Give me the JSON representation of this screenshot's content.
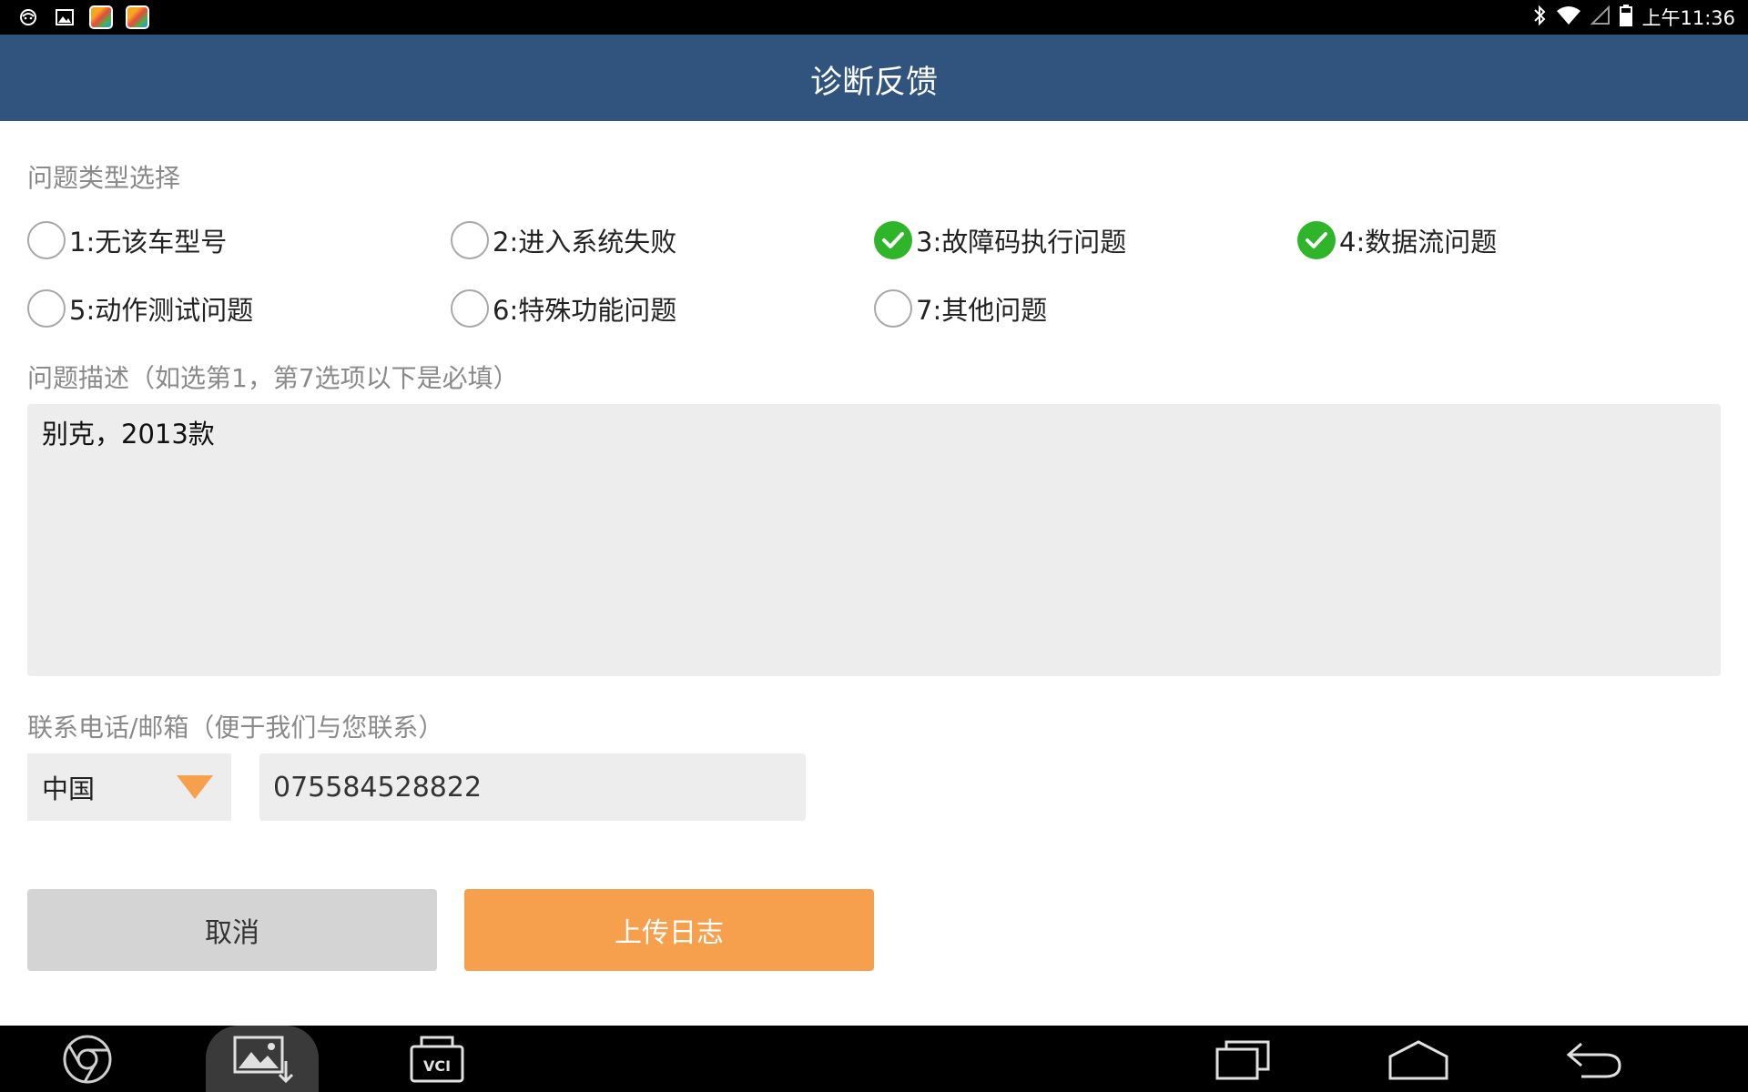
{
  "status_bar": {
    "time": "上午11:36"
  },
  "header": {
    "title": "诊断反馈"
  },
  "problem_type": {
    "label": "问题类型选择",
    "options": [
      {
        "label": "1:无该车型号",
        "checked": false
      },
      {
        "label": "2:进入系统失败",
        "checked": false
      },
      {
        "label": "3:故障码执行问题",
        "checked": true
      },
      {
        "label": "4:数据流问题",
        "checked": true
      },
      {
        "label": "5:动作测试问题",
        "checked": false
      },
      {
        "label": "6:特殊功能问题",
        "checked": false
      },
      {
        "label": "7:其他问题",
        "checked": false
      }
    ]
  },
  "description": {
    "label": "问题描述（如选第1，第7选项以下是必填）",
    "value": "别克，2013款"
  },
  "contact": {
    "label": "联系电话/邮箱（便于我们与您联系）",
    "country": "中国",
    "phone": "075584528822"
  },
  "buttons": {
    "cancel": "取消",
    "upload": "上传日志"
  },
  "navbar": {
    "vci_label": "VCI"
  },
  "colors": {
    "header": "#30547e",
    "accent": "#f6a04d",
    "checked": "#2fb52a"
  }
}
